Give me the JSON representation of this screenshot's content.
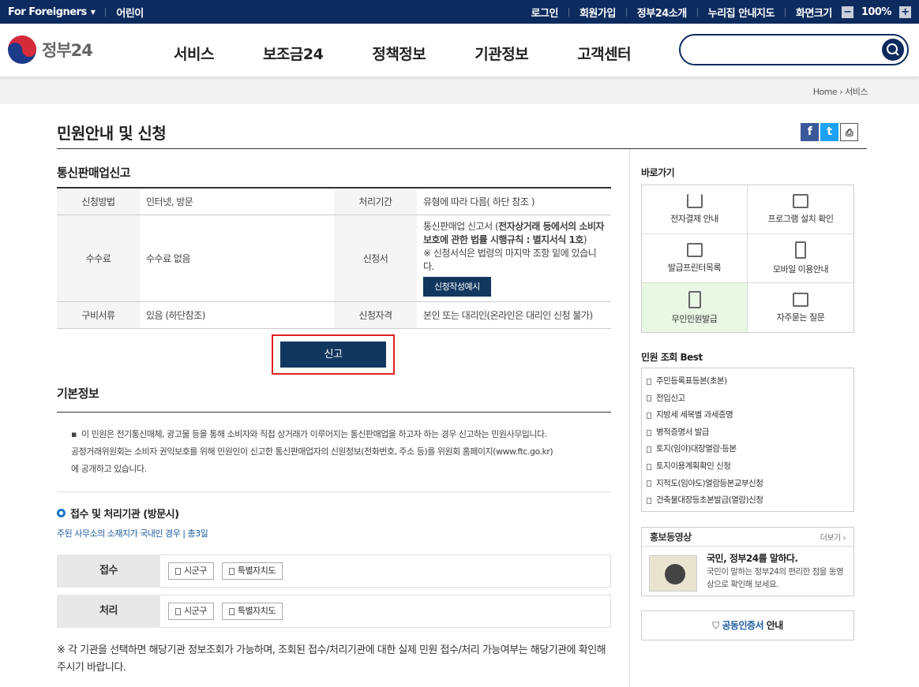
{
  "topbar": {
    "foreigners": "For Foreigners",
    "kids": "어린이",
    "login": "로그인",
    "join": "회원가입",
    "about": "정부24소개",
    "sitemap": "누리집 안내지도",
    "screen_size": "화면크기",
    "zoom": "100%"
  },
  "header": {
    "logo": "정부24",
    "nav": [
      "서비스",
      "보조금24",
      "정책정보",
      "기관정보",
      "고객센터"
    ],
    "search_placeholder": ""
  },
  "breadcrumb": {
    "home": "Home",
    "current": "서비스"
  },
  "page": {
    "title": "민원안내 및 신청",
    "section": "통신판매업신고"
  },
  "info_table": {
    "r1": {
      "h1": "신청방법",
      "v1": "인터넷, 방문",
      "h2": "처리기간",
      "v2": "유형에 따라 다름( 하단 참조 )"
    },
    "r2": {
      "h1": "수수료",
      "v1": "수수료 없음",
      "h2": "신청서",
      "v2a": "통신판매업 신고서 (",
      "v2b": "전자상거래 등에서의 소비자 보호에 관한 법률 시행규칙 : 별지서식 1호",
      "v2c": ")",
      "v2d": "※ 신청서식은 법령의 마지막 조항 밑에 있습니다.",
      "apply_example": "신청작성예시"
    },
    "r3": {
      "h1": "구비서류",
      "v1": "있음 (하단참조)",
      "h2": "신청자격",
      "v2": "본인 또는 대리인(온라인은 대리인 신청 불가)"
    }
  },
  "report_button": "신고",
  "basic": {
    "title": "기본정보",
    "desc1": "이 민원은 전기통신매체, 광고물 등을 통해 소비자와 직접 상거래가 이루어지는 통신판매업을 하고자 하는 경우 신고하는 민원사무입니다.",
    "desc2": "공정거래위원회는 소비자 권익보호를 위해 민원인이 신고한 통신판매업자의 신원정보(전화번호, 주소 등)를 위원회 홈페이지(www.ftc.go.kr)",
    "desc3": "에 공개하고 있습니다."
  },
  "agency": {
    "title": "접수 및 처리기관 (방문시)",
    "note": "주된 사무소의 소재지가 국내인 경우 | 총3일",
    "rows": [
      {
        "label": "접수",
        "b1": "시군구",
        "b2": "특별자치도"
      },
      {
        "label": "처리",
        "b1": "시군구",
        "b2": "특별자치도"
      }
    ],
    "footnote": "※ 각 기관을 선택하면 해당기관 정보조회가 가능하며, 조회된 접수/처리기관에 대한 실제 민원 접수/처리 가능여부는 해당기관에 확인해 주시기 바랍니다."
  },
  "sidebar": {
    "shortcut_title": "바로가기",
    "shortcuts": [
      "전자결제 안내",
      "프로그램 설치 확인",
      "발급프린터목록",
      "모바일 이용안내",
      "무인민원발급",
      "자주묻는 질문"
    ],
    "best_title": "민원 조회 Best",
    "best": [
      "주민등록표등본(초본)",
      "전입신고",
      "지방세 세목별 과세증명",
      "병적증명서 발급",
      "토지(임야)대장열람·등본",
      "토지이용계획확인 신청",
      "지적도(임야도)열람등본교부신청",
      "건축물대장등초본발급(열람)신청"
    ],
    "promo_title": "홍보동영상",
    "promo_more": "더보기",
    "promo_head": "국민, 정부24를 말하다.",
    "promo_desc": "국민이 말하는 정부24의 편리한 점을 동영상으로 확인해 보세요.",
    "cert_a": "공동인증서",
    "cert_b": " 안내"
  },
  "colors": {
    "navy": "#0d2b5e",
    "button": "#12375f",
    "highlight": "#e02020",
    "link": "#1a5aa0"
  }
}
